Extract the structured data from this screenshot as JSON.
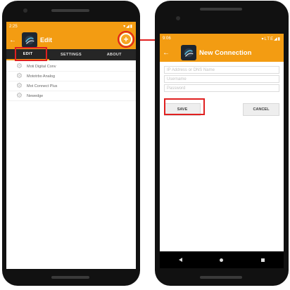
{
  "left_phone": {
    "status": {
      "time": "2:25",
      "icons": "▾◢▮"
    },
    "appbar": {
      "back_icon": "arrow-left-icon",
      "title": "Edit",
      "add_icon": "plus-circle-icon",
      "add_symbol": "+"
    },
    "tabs": [
      {
        "label": "EDIT",
        "active": true
      },
      {
        "label": "SETTINGS",
        "active": false
      },
      {
        "label": "ABOUT",
        "active": false
      }
    ],
    "items": [
      {
        "label": "Moti Digital Conv"
      },
      {
        "label": "Mototrbo Analog"
      },
      {
        "label": "Mot Connect Plus"
      },
      {
        "label": "Newedge"
      }
    ]
  },
  "right_phone": {
    "status": {
      "time": "9:06",
      "icons": "▾LTE◢▮"
    },
    "appbar": {
      "back_icon": "arrow-left-icon",
      "title": "New Connection"
    },
    "fields": [
      {
        "placeholder": "IP Address or DNS Name"
      },
      {
        "placeholder": "Username"
      },
      {
        "placeholder": "Password"
      }
    ],
    "buttons": {
      "save": "SAVE",
      "cancel": "CANCEL"
    },
    "nav": {
      "back": "nav-back-icon",
      "home": "nav-home-icon",
      "recent": "nav-recent-icon"
    }
  },
  "annotation_color": "#e02020",
  "accent_color": "#f39c12"
}
